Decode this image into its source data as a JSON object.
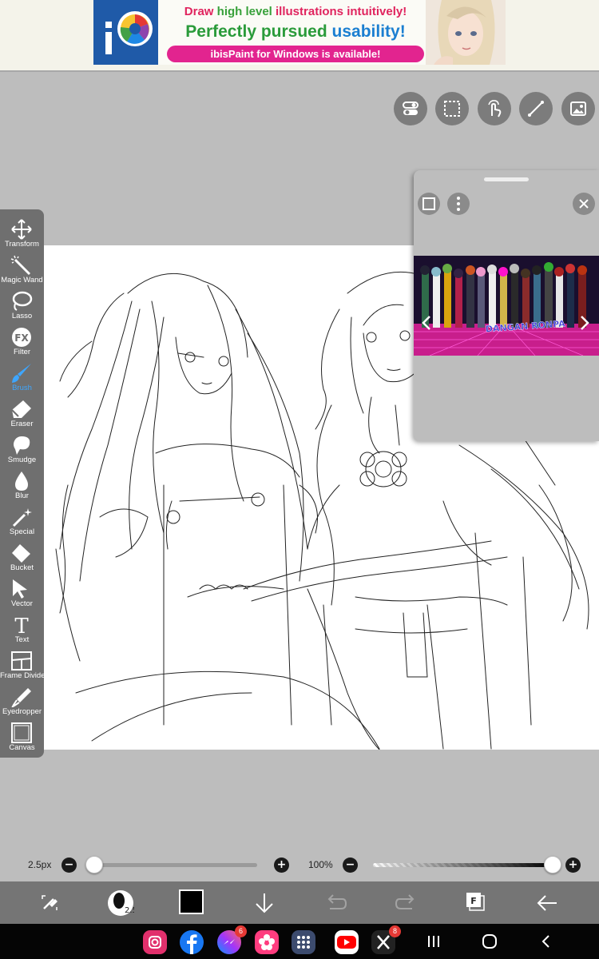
{
  "ad": {
    "line1_a": "Draw ",
    "line1_b": "high level",
    "line1_c": " illustrations intuitively!",
    "line2_a": "Perfectly pursued ",
    "line2_b": "usability!",
    "pill": "ibisPaint for Windows is available!",
    "logo_text": "iP"
  },
  "top_tools": [
    {
      "name": "toggle-icon"
    },
    {
      "name": "selection-icon"
    },
    {
      "name": "touch-icon"
    },
    {
      "name": "ruler-icon"
    },
    {
      "name": "image-icon"
    }
  ],
  "toolbar": {
    "items": [
      {
        "label": "Transform",
        "icon": "transform-icon"
      },
      {
        "label": "Magic Wand",
        "icon": "magic-wand-icon"
      },
      {
        "label": "Lasso",
        "icon": "lasso-icon"
      },
      {
        "label": "Filter",
        "icon": "filter-icon",
        "glyph": "FX"
      },
      {
        "label": "Brush",
        "icon": "brush-icon",
        "active": true
      },
      {
        "label": "Eraser",
        "icon": "eraser-icon"
      },
      {
        "label": "Smudge",
        "icon": "smudge-icon"
      },
      {
        "label": "Blur",
        "icon": "blur-icon"
      },
      {
        "label": "Special",
        "icon": "special-icon"
      },
      {
        "label": "Bucket",
        "icon": "bucket-icon"
      },
      {
        "label": "Vector",
        "icon": "vector-icon"
      },
      {
        "label": "Text",
        "icon": "text-icon",
        "glyph": "T"
      },
      {
        "label": "Frame Divider",
        "icon": "frame-divider-icon"
      },
      {
        "label": "Eyedropper",
        "icon": "eyedropper-icon"
      },
      {
        "label": "Canvas",
        "icon": "canvas-icon"
      }
    ],
    "active_color": "#3ea6ff"
  },
  "reference_window": {
    "banner_title": "DANGAN RONPA"
  },
  "brush_size": {
    "value": "2.5px",
    "level": 0.0
  },
  "opacity": {
    "value": "100%",
    "level": 1.0
  },
  "bottom_bar": {
    "brush_preview_value": "2.5",
    "color": "#000000",
    "layers_glyph": "F"
  },
  "nav_dock": [
    {
      "name": "instagram-app-icon",
      "color": "#e1306c"
    },
    {
      "name": "facebook-app-icon",
      "color": "#1877f2",
      "badge": ""
    },
    {
      "name": "messenger-app-icon",
      "color": "#a050f0",
      "badge": "6"
    },
    {
      "name": "blossom-app-icon",
      "color": "#ff3d7f"
    },
    {
      "name": "apps-grid-icon",
      "color": "#3c4b6e"
    },
    {
      "name": "youtube-app-icon",
      "color": "#ff0000"
    },
    {
      "name": "x-app-icon",
      "color": "#222222",
      "badge": "8"
    }
  ],
  "colors": {
    "app_background": "#bdbdbd",
    "toolbar": "#6f6f6f",
    "ad_pink": "#e2248f",
    "ad_green": "#2a9b3a"
  }
}
